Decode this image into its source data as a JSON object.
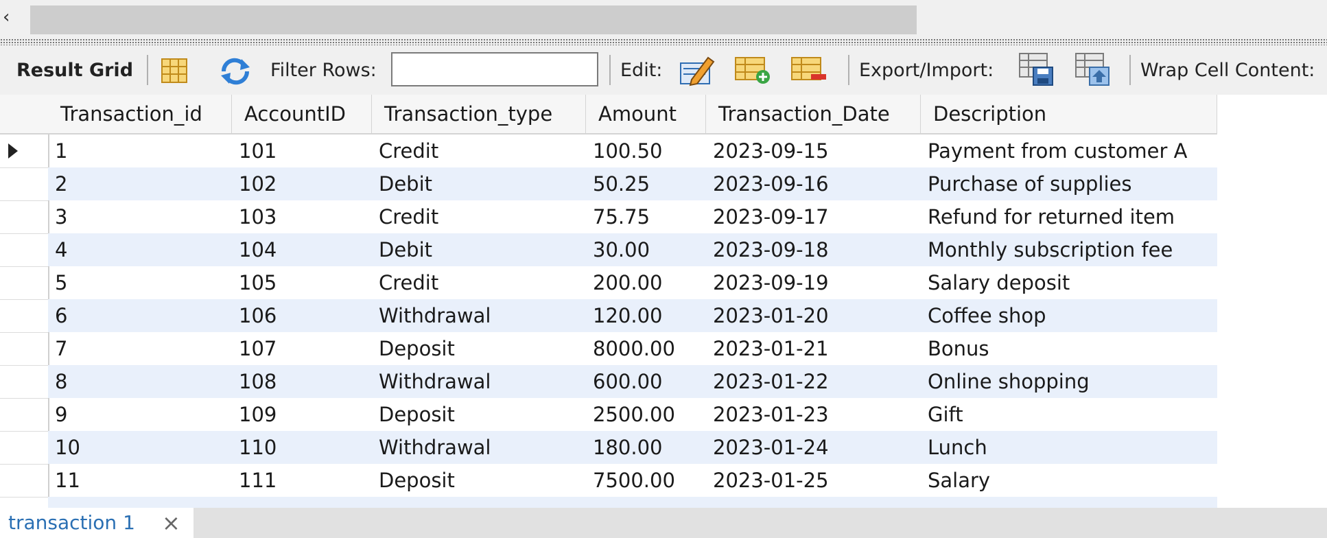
{
  "scroll_left_arrow": "‹",
  "toolbar": {
    "result_grid_label": "Result Grid",
    "filter_rows_label": "Filter Rows:",
    "filter_value": "",
    "edit_label": "Edit:",
    "export_import_label": "Export/Import:",
    "wrap_cell_label": "Wrap Cell Content:"
  },
  "grid": {
    "columns": [
      "Transaction_id",
      "AccountID",
      "Transaction_type",
      "Amount",
      "Transaction_Date",
      "Description"
    ],
    "rows": [
      [
        "1",
        "101",
        "Credit",
        "100.50",
        "2023-09-15",
        "Payment from customer A"
      ],
      [
        "2",
        "102",
        "Debit",
        "50.25",
        "2023-09-16",
        "Purchase of supplies"
      ],
      [
        "3",
        "103",
        "Credit",
        "75.75",
        "2023-09-17",
        "Refund for returned item"
      ],
      [
        "4",
        "104",
        "Debit",
        "30.00",
        "2023-09-18",
        "Monthly subscription fee"
      ],
      [
        "5",
        "105",
        "Credit",
        "200.00",
        "2023-09-19",
        "Salary deposit"
      ],
      [
        "6",
        "106",
        "Withdrawal",
        "120.00",
        "2023-01-20",
        "Coffee shop"
      ],
      [
        "7",
        "107",
        "Deposit",
        "8000.00",
        "2023-01-21",
        "Bonus"
      ],
      [
        "8",
        "108",
        "Withdrawal",
        "600.00",
        "2023-01-22",
        "Online shopping"
      ],
      [
        "9",
        "109",
        "Deposit",
        "2500.00",
        "2023-01-23",
        "Gift"
      ],
      [
        "10",
        "110",
        "Withdrawal",
        "180.00",
        "2023-01-24",
        "Lunch"
      ],
      [
        "11",
        "111",
        "Deposit",
        "7500.00",
        "2023-01-25",
        "Salary"
      ]
    ]
  },
  "tabs": [
    {
      "label": "transaction 1",
      "close": "×"
    }
  ],
  "colors": {
    "alt_row": "#e9f0fb",
    "tab_text": "#2a6fb3",
    "toolbar_bg": "#f0f0f0"
  }
}
